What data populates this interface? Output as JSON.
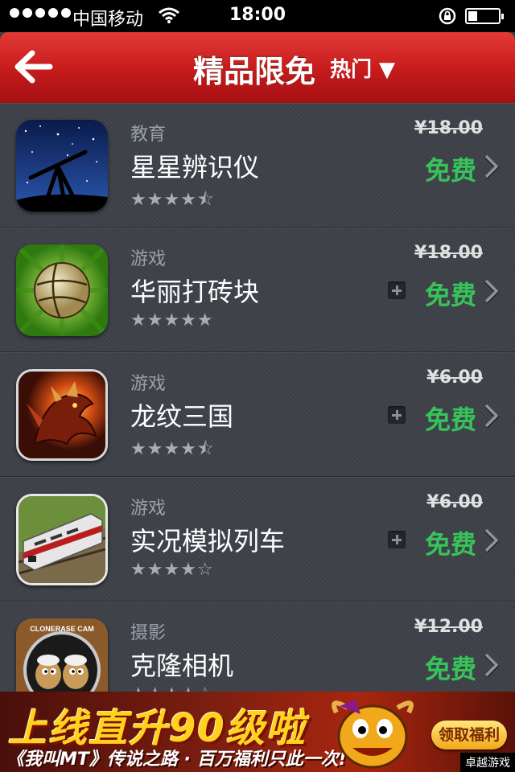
{
  "status_bar": {
    "carrier": "中国移动",
    "time": "18:00",
    "battery_level": 0.3
  },
  "nav": {
    "title": "精品限免",
    "filter_label": "热门 ▼",
    "back_icon": "back-arrow-icon"
  },
  "apps": [
    {
      "category": "教育",
      "name": "星星辨识仪",
      "rating": "★★★★⯪",
      "old_price": "¥18.00",
      "price": "免费",
      "addable": false,
      "icon": "telescope-icon"
    },
    {
      "category": "游戏",
      "name": "华丽打砖块",
      "rating": "★★★★★",
      "old_price": "¥18.00",
      "price": "免费",
      "addable": true,
      "icon": "ball-icon"
    },
    {
      "category": "游戏",
      "name": "龙纹三国",
      "rating": "★★★★⯪",
      "old_price": "¥6.00",
      "price": "免费",
      "addable": true,
      "icon": "dragon-icon"
    },
    {
      "category": "游戏",
      "name": "实况模拟列车",
      "rating": "★★★★☆",
      "old_price": "¥6.00",
      "price": "免费",
      "addable": true,
      "icon": "train-icon"
    },
    {
      "category": "摄影",
      "name": "克隆相机",
      "rating": "★★★★☆",
      "old_price": "¥12.00",
      "price": "免费",
      "addable": false,
      "icon": "camera-sheep-icon",
      "icon_text": "CLONERASE CAM"
    }
  ],
  "ad": {
    "headline": "上线直升90级啦",
    "subline": "《我叫MT》传说之路 · 百万福利只此一次!",
    "cta": "领取福利",
    "watermark": "卓越游戏"
  },
  "colors": {
    "nav_red": "#c81d1d",
    "free_green": "#37c35a",
    "list_bg": "#3d4148"
  }
}
